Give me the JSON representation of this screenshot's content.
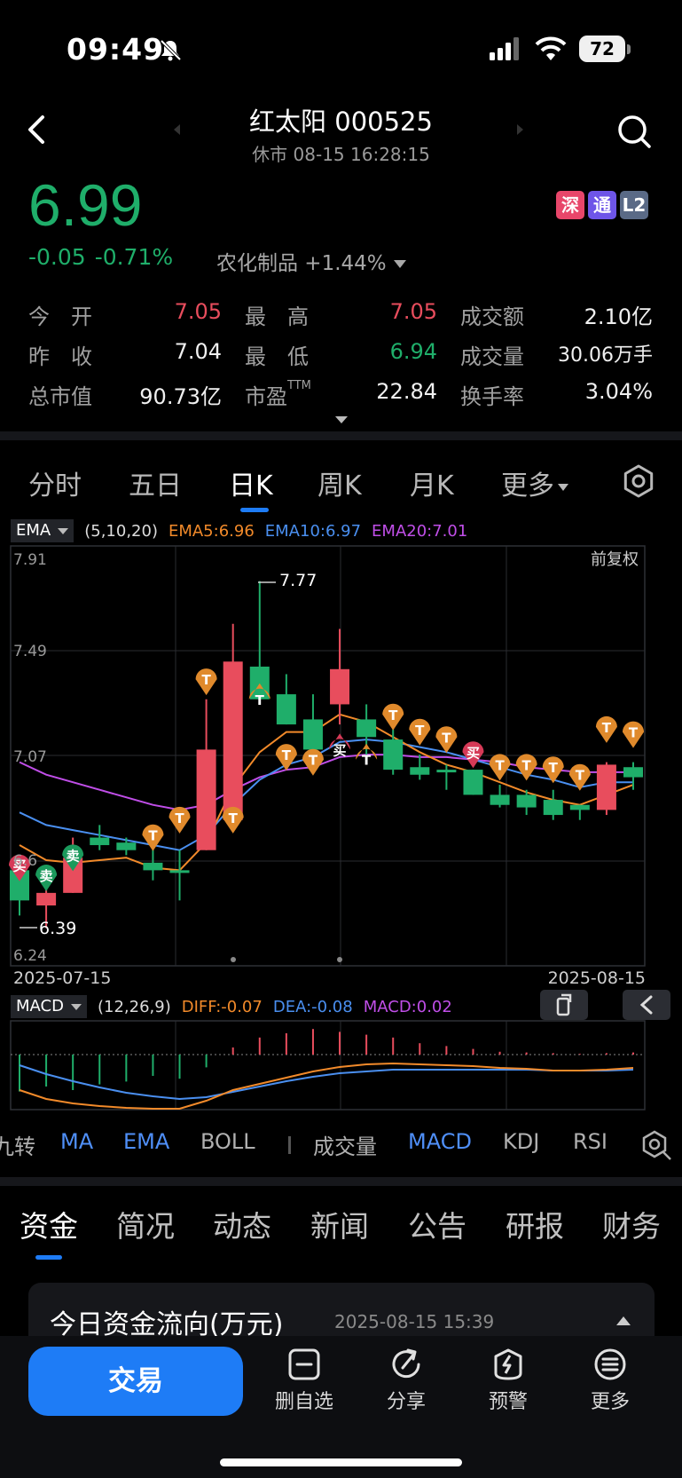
{
  "status": {
    "time": "09:49",
    "battery": "72"
  },
  "header": {
    "title": "红太阳 000525",
    "subtitle": "休市 08-15 16:28:15"
  },
  "quote": {
    "price": "6.99",
    "change": "-0.05",
    "change_pct": "-0.71%",
    "sector": "农化制品 +1.44%",
    "badges": [
      "深",
      "通",
      "L2"
    ],
    "fields": {
      "open_label": "今　开",
      "open": "7.05",
      "high_label": "最　高",
      "high": "7.05",
      "amount_label": "成交额",
      "amount": "2.10亿",
      "prev_label": "昨　收",
      "prev": "7.04",
      "low_label": "最　低",
      "low": "6.94",
      "volume_label": "成交量",
      "volume": "30.06万手",
      "mcap_label": "总市值",
      "mcap": "90.73亿",
      "pe_label": "市盈",
      "pe_sup": "TTM",
      "pe": "22.84",
      "turnover_label": "换手率",
      "turnover": "3.04%"
    }
  },
  "period_tabs": [
    "分时",
    "五日",
    "日K",
    "周K",
    "月K",
    "更多"
  ],
  "active_period": "日K",
  "ema_row": {
    "selector": "EMA",
    "params": "(5,10,20)",
    "ema5": "EMA5:6.96",
    "ema10": "EMA10:6.97",
    "ema20": "EMA20:7.01"
  },
  "macd_row": {
    "selector": "MACD",
    "params": "(12,26,9)",
    "diff": "DIFF:-0.07",
    "dea": "DEA:-0.08",
    "macd": "MACD:0.02"
  },
  "chart_labels": {
    "fq": "前复权",
    "y_top": "7.91",
    "y_mid1": "7.49",
    "y_mid2": "7.07",
    "y_mid3": "6.6",
    "y_bottom": "6.24",
    "x_start": "2025-07-15",
    "x_end": "2025-08-15",
    "hi_label": "7.77",
    "lo_label": "6.39"
  },
  "chart_data": {
    "type": "candlestick",
    "x": [
      "2025-07-15",
      "2025-08-15"
    ],
    "ylim": [
      6.24,
      7.91
    ],
    "y_ticks": [
      "7.91",
      "7.49",
      "7.07",
      "6.6",
      "6.24"
    ],
    "candles": [
      {
        "o": 6.62,
        "h": 6.62,
        "l": 6.44,
        "c": 6.5
      },
      {
        "o": 6.48,
        "h": 6.55,
        "l": 6.39,
        "c": 6.53
      },
      {
        "o": 6.53,
        "h": 6.75,
        "l": 6.53,
        "c": 6.67
      },
      {
        "o": 6.75,
        "h": 6.8,
        "l": 6.7,
        "c": 6.72
      },
      {
        "o": 6.73,
        "h": 6.75,
        "l": 6.68,
        "c": 6.7
      },
      {
        "o": 6.65,
        "h": 6.72,
        "l": 6.58,
        "c": 6.62
      },
      {
        "o": 6.62,
        "h": 6.7,
        "l": 6.5,
        "c": 6.61
      },
      {
        "o": 6.7,
        "h": 7.3,
        "l": 6.7,
        "c": 7.1
      },
      {
        "o": 6.82,
        "h": 7.6,
        "l": 6.82,
        "c": 7.45
      },
      {
        "o": 7.43,
        "h": 7.77,
        "l": 7.3,
        "c": 7.3
      },
      {
        "o": 7.32,
        "h": 7.4,
        "l": 7.2,
        "c": 7.2
      },
      {
        "o": 7.22,
        "h": 7.32,
        "l": 7.1,
        "c": 7.1
      },
      {
        "o": 7.28,
        "h": 7.58,
        "l": 7.2,
        "c": 7.42
      },
      {
        "o": 7.22,
        "h": 7.28,
        "l": 7.08,
        "c": 7.15
      },
      {
        "o": 7.14,
        "h": 7.18,
        "l": 7.0,
        "c": 7.02
      },
      {
        "o": 7.03,
        "h": 7.08,
        "l": 6.98,
        "c": 7.0
      },
      {
        "o": 7.02,
        "h": 7.04,
        "l": 6.94,
        "c": 7.01
      },
      {
        "o": 7.02,
        "h": 7.02,
        "l": 6.92,
        "c": 6.92
      },
      {
        "o": 6.92,
        "h": 6.96,
        "l": 6.87,
        "c": 6.88
      },
      {
        "o": 6.92,
        "h": 6.94,
        "l": 6.84,
        "c": 6.87
      },
      {
        "o": 6.9,
        "h": 6.94,
        "l": 6.82,
        "c": 6.84
      },
      {
        "o": 6.88,
        "h": 6.88,
        "l": 6.82,
        "c": 6.86
      },
      {
        "o": 6.86,
        "h": 7.05,
        "l": 6.84,
        "c": 7.04
      },
      {
        "o": 7.03,
        "h": 7.05,
        "l": 6.94,
        "c": 6.99
      }
    ],
    "ema5": [
      6.72,
      6.66,
      6.65,
      6.66,
      6.67,
      6.63,
      6.62,
      6.73,
      6.95,
      7.09,
      7.17,
      7.17,
      7.24,
      7.21,
      7.15,
      7.09,
      7.04,
      7.01,
      6.97,
      6.93,
      6.9,
      6.88,
      6.92,
      6.96
    ],
    "ema10": [
      6.85,
      6.8,
      6.78,
      6.76,
      6.74,
      6.72,
      6.7,
      6.76,
      6.88,
      6.98,
      7.04,
      7.07,
      7.13,
      7.14,
      7.13,
      7.11,
      7.09,
      7.06,
      7.03,
      7.0,
      6.98,
      6.95,
      6.97,
      6.97
    ],
    "ema20": [
      7.05,
      7.0,
      6.97,
      6.94,
      6.91,
      6.88,
      6.86,
      6.88,
      6.94,
      6.99,
      7.02,
      7.03,
      7.07,
      7.08,
      7.08,
      7.07,
      7.07,
      7.06,
      7.05,
      7.03,
      7.02,
      7.01,
      7.01,
      7.01
    ]
  },
  "indicator_tabs": [
    "九转",
    "MA",
    "EMA",
    "BOLL",
    "成交量",
    "MACD",
    "KDJ",
    "RSI"
  ],
  "section_tabs": [
    "资金",
    "简况",
    "动态",
    "新闻",
    "公告",
    "研报",
    "财务"
  ],
  "fund_flow": {
    "title": "今日资金流向(万元)",
    "time": "2025-08-15 15:39"
  },
  "bottom": {
    "trade": "交易",
    "remove": "删自选",
    "share": "分享",
    "alert": "预警",
    "more": "更多"
  },
  "colors": {
    "up": "#e84d5d",
    "down": "#1fae6a",
    "ema5": "#f28a2a",
    "ema10": "#4a8ff0",
    "ema20": "#c04ee8",
    "accent": "#1e7cf6"
  }
}
